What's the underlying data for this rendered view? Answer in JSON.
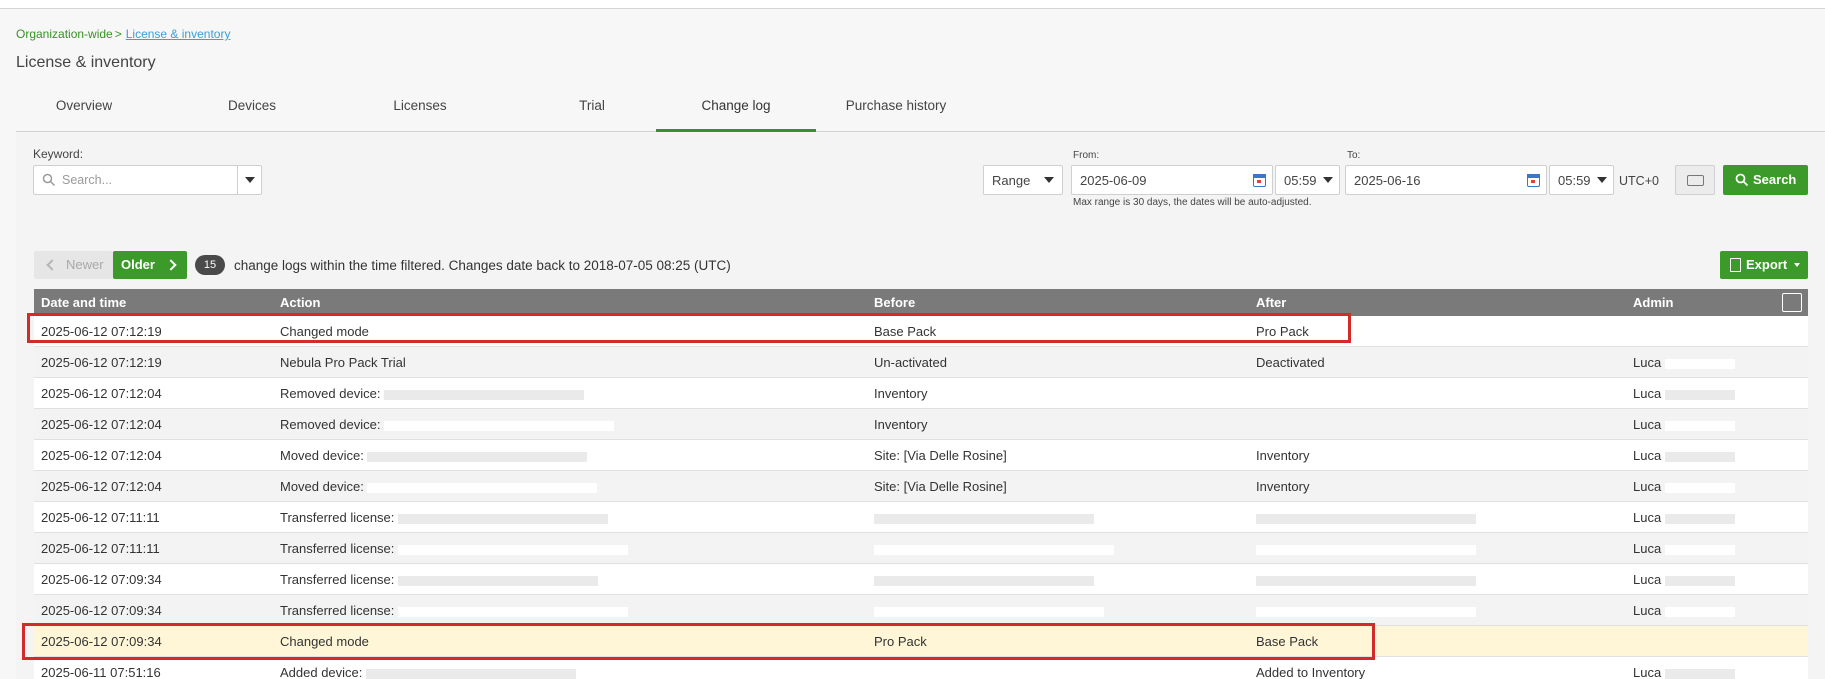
{
  "breadcrumb": {
    "parent": "Organization-wide",
    "separator": ">",
    "current": "License & inventory"
  },
  "page_title": "License & inventory",
  "tabs": [
    {
      "label": "Overview",
      "active": false
    },
    {
      "label": "Devices",
      "active": false
    },
    {
      "label": "Licenses",
      "active": false
    },
    {
      "label": "Trial",
      "active": false
    },
    {
      "label": "Change log",
      "active": true
    },
    {
      "label": "Purchase history",
      "active": false
    }
  ],
  "filters": {
    "keyword_label": "Keyword:",
    "keyword_placeholder": "Search...",
    "range_value": "Range",
    "from_label": "From:",
    "from_date": "2025-06-09",
    "from_time": "05:59",
    "to_label": "To:",
    "to_date": "2025-06-16",
    "to_time": "05:59",
    "timezone": "UTC+0",
    "hint": "Max range is 30 days, the dates will be auto-adjusted.",
    "search_label": "Search"
  },
  "pager": {
    "newer_label": "Newer",
    "older_label": "Older",
    "count": "15",
    "summary": "change logs within the time filtered. Changes date back to 2018-07-05 08:25 (UTC)",
    "export_label": "Export"
  },
  "table": {
    "headers": {
      "date": "Date and time",
      "action": "Action",
      "before": "Before",
      "after": "After",
      "admin": "Admin"
    },
    "rows": [
      {
        "date": "2025-06-12 07:12:19",
        "action": "Changed mode",
        "before": "Base Pack",
        "after": "Pro Pack",
        "admin": ""
      },
      {
        "date": "2025-06-12 07:12:19",
        "action": "Nebula Pro Pack Trial",
        "before": "Un-activated",
        "after": "Deactivated",
        "admin": "Luca"
      },
      {
        "date": "2025-06-12 07:12:04",
        "action": "Removed device:",
        "before": "Inventory",
        "after": "",
        "admin": "Luca"
      },
      {
        "date": "2025-06-12 07:12:04",
        "action": "Removed device:",
        "before": "Inventory",
        "after": "",
        "admin": "Luca"
      },
      {
        "date": "2025-06-12 07:12:04",
        "action": "Moved device:",
        "before": "Site: [Via Delle Rosine]",
        "after": "Inventory",
        "admin": "Luca"
      },
      {
        "date": "2025-06-12 07:12:04",
        "action": "Moved device:",
        "before": "Site: [Via Delle Rosine]",
        "after": "Inventory",
        "admin": "Luca"
      },
      {
        "date": "2025-06-12 07:11:11",
        "action": "Transferred license:",
        "before": "",
        "after": "",
        "admin": "Luca"
      },
      {
        "date": "2025-06-12 07:11:11",
        "action": "Transferred license:",
        "before": "",
        "after": "",
        "admin": "Luca"
      },
      {
        "date": "2025-06-12 07:09:34",
        "action": "Transferred license:",
        "before": "",
        "after": "",
        "admin": "Luca"
      },
      {
        "date": "2025-06-12 07:09:34",
        "action": "Transferred license:",
        "before": "",
        "after": "",
        "admin": "Luca"
      },
      {
        "date": "2025-06-12 07:09:34",
        "action": "Changed mode",
        "before": "Pro Pack",
        "after": "Base Pack",
        "admin": ""
      },
      {
        "date": "2025-06-11 07:51:16",
        "action": "Added device:",
        "before": "",
        "after": "Added to Inventory",
        "admin": "Luca"
      }
    ]
  },
  "colors": {
    "accent_green": "#3b9a2a",
    "highlight_red": "#d42a2a",
    "highlight_row": "#fff6d8",
    "header_gray": "#7a7a7a"
  },
  "icons": [
    "search-icon",
    "calendar-icon",
    "clear-icon",
    "chevron-left-icon",
    "chevron-right-icon",
    "export-icon",
    "column-settings-icon",
    "chevron-down-icon"
  ]
}
